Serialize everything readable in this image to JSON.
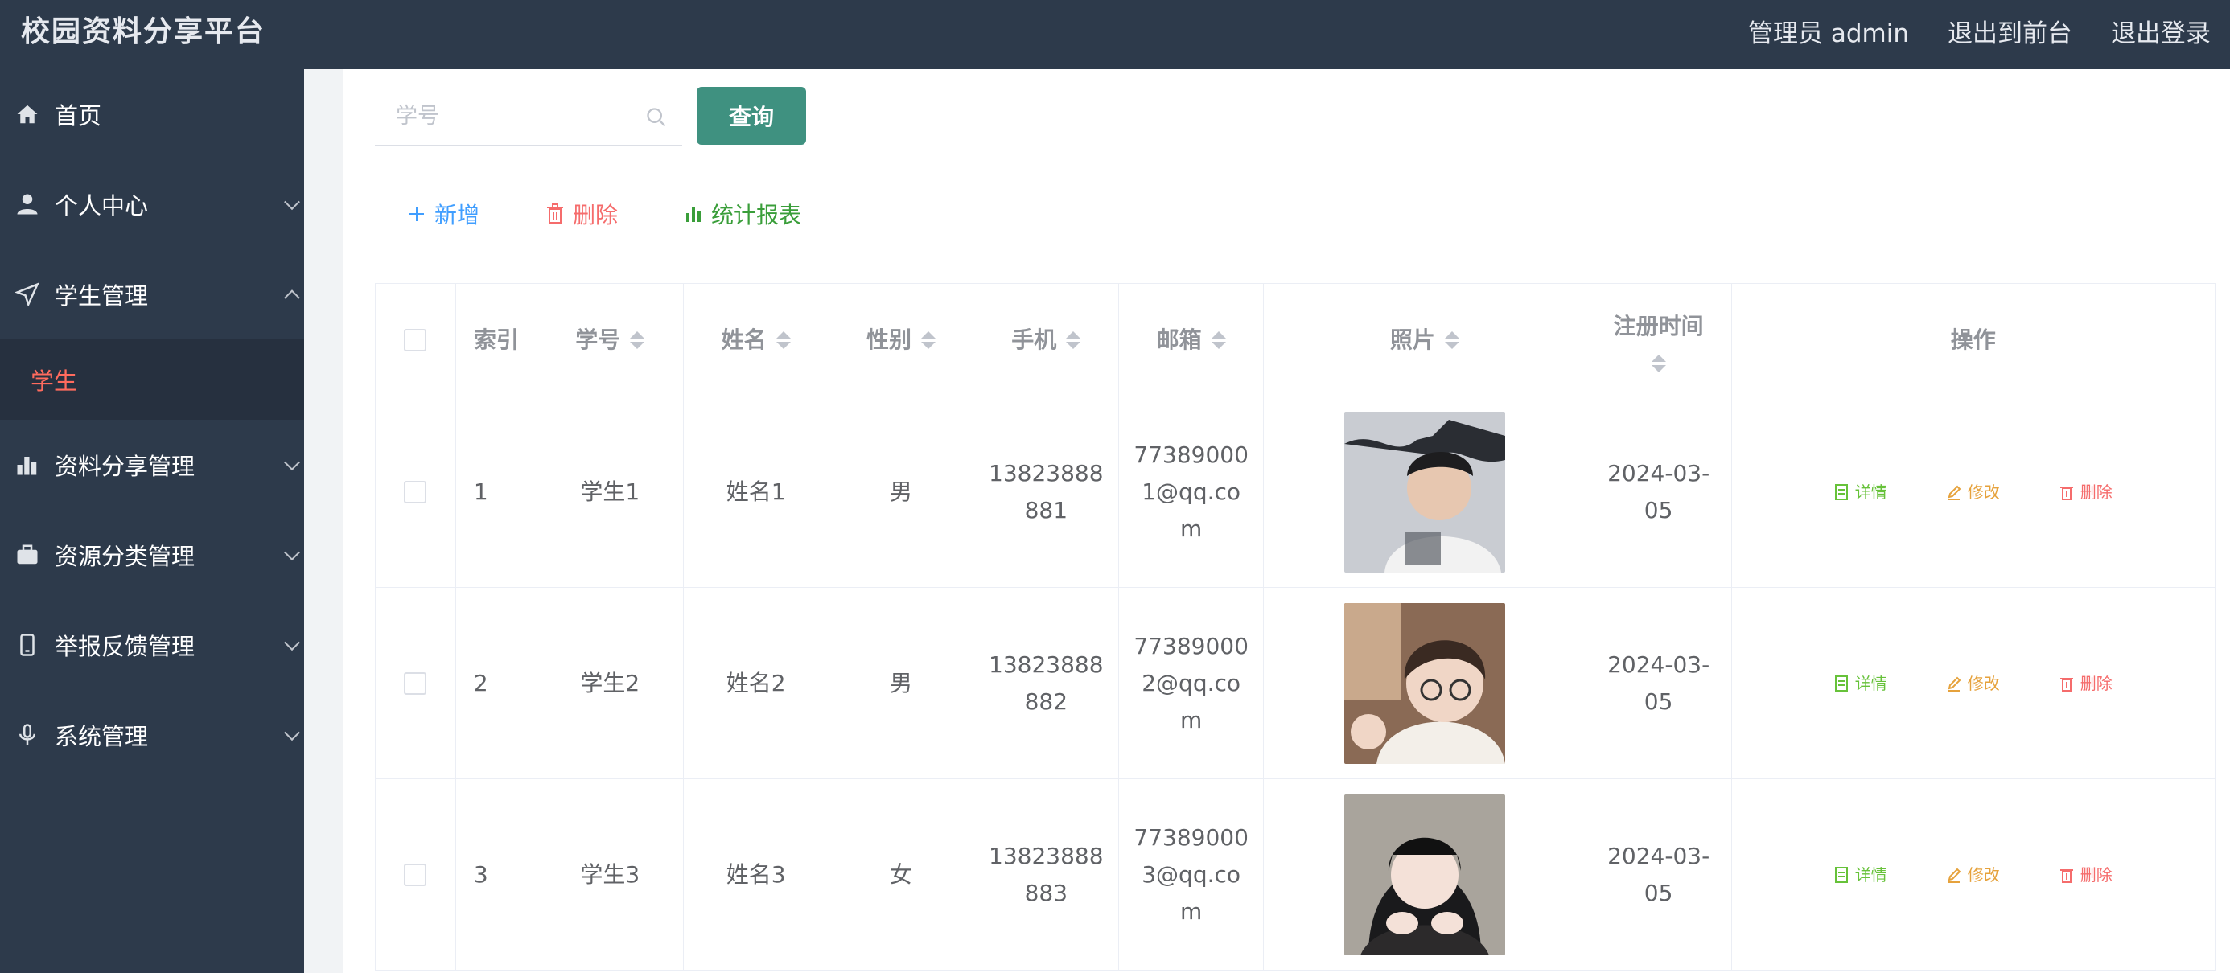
{
  "header": {
    "brand": "校园资料分享平台",
    "admin_label": "管理员 admin",
    "to_front": "退出到前台",
    "logout": "退出登录"
  },
  "sidebar": {
    "items": [
      {
        "label": "首页",
        "icon": "home-icon"
      },
      {
        "label": "个人中心",
        "icon": "user-icon"
      },
      {
        "label": "学生管理",
        "icon": "send-icon"
      },
      {
        "label": "资料分享管理",
        "icon": "bar-chart-icon"
      },
      {
        "label": "资源分类管理",
        "icon": "briefcase-icon"
      },
      {
        "label": "举报反馈管理",
        "icon": "mobile-icon"
      },
      {
        "label": "系统管理",
        "icon": "microphone-icon"
      }
    ],
    "active_sub": "学生"
  },
  "search": {
    "placeholder": "学号",
    "button": "查询"
  },
  "actions": {
    "add": "新增",
    "delete": "删除",
    "report": "统计报表"
  },
  "colors": {
    "add": "#409eff",
    "delete": "#f56c6c",
    "report": "#3a9e3a",
    "detail": "#67c23a",
    "edit": "#e6a23c",
    "op_delete": "#f56c6c",
    "header_bg": "#2d3a4b",
    "query_btn": "#3f9180",
    "active_sub": "#ff6b5e"
  },
  "table": {
    "headers": [
      "索引",
      "学号",
      "姓名",
      "性别",
      "手机",
      "邮箱",
      "照片",
      "注册时间",
      "操作"
    ],
    "rows": [
      {
        "index": "1",
        "student_no": "学生1",
        "name": "姓名1",
        "gender": "男",
        "phone": "13823888881",
        "email": "773890001@qq.com",
        "date": "2024-03-05"
      },
      {
        "index": "2",
        "student_no": "学生2",
        "name": "姓名2",
        "gender": "男",
        "phone": "13823888882",
        "email": "773890002@qq.com",
        "date": "2024-03-05"
      },
      {
        "index": "3",
        "student_no": "学生3",
        "name": "姓名3",
        "gender": "女",
        "phone": "13823888883",
        "email": "773890003@qq.com",
        "date": "2024-03-05"
      }
    ],
    "ops": {
      "detail": "详情",
      "edit": "修改",
      "delete": "删除"
    }
  }
}
